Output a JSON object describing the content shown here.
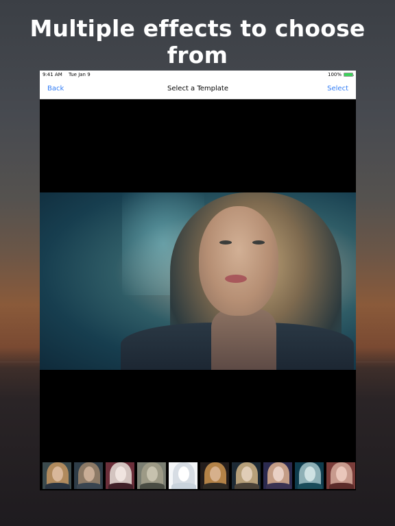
{
  "headline": "Multiple effects to choose from",
  "status": {
    "time": "9:41 AM",
    "date": "Tue Jan 9",
    "battery": "100%"
  },
  "nav": {
    "back_label": "Back",
    "title": "Select a Template",
    "select_label": "Select"
  },
  "thumbnails": [
    {
      "bg": "#3b4a4d",
      "hair": "#b08a5d",
      "face": "#d8b79a",
      "body": "#2a3440"
    },
    {
      "bg": "#2f3d48",
      "hair": "#8d7a66",
      "face": "#c9ad96",
      "body": "#3a4550"
    },
    {
      "bg": "#6b2f3a",
      "hair": "#d3c4c0",
      "face": "#f0e4e0",
      "body": "#402028"
    },
    {
      "bg": "#7b7f73",
      "hair": "#9d9a86",
      "face": "#c7c2ae",
      "body": "#4a4d44"
    },
    {
      "bg": "#f4f6f8",
      "hair": "#d7dde4",
      "face": "#ffffff",
      "body": "#c9d3dc"
    },
    {
      "bg": "#231d1c",
      "hair": "#b38247",
      "face": "#d6b08c",
      "body": "#2f2a24"
    },
    {
      "bg": "#1d2a35",
      "hair": "#b7a07a",
      "face": "#e0cdb7",
      "body": "#4a4238"
    },
    {
      "bg": "#2b2a4f",
      "hair": "#c49d86",
      "face": "#e9d0c5",
      "body": "#3a3252"
    },
    {
      "bg": "#0f3c4d",
      "hair": "#8eb0b6",
      "face": "#cfe2e3",
      "body": "#1a4c5a"
    },
    {
      "bg": "#7a3d3a",
      "hair": "#c79a8d",
      "face": "#eac7bb",
      "body": "#5c2c2a"
    }
  ],
  "colors": {
    "accent": "#2f7bf5",
    "battery": "#3bd35a"
  }
}
